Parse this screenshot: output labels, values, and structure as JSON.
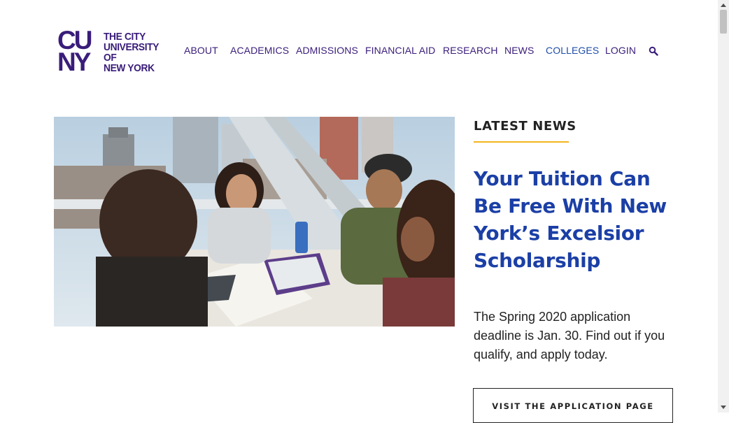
{
  "header": {
    "logo": {
      "mark_line1": "CU",
      "mark_line2": "NY",
      "text_lines": [
        "THE CITY",
        "UNIVERSITY",
        "OF",
        "NEW YORK"
      ]
    },
    "nav": [
      {
        "label": "ABOUT"
      },
      {
        "label": "ACADEMICS"
      },
      {
        "label": "ADMISSIONS"
      },
      {
        "label": "FINANCIAL AID"
      },
      {
        "label": "RESEARCH"
      },
      {
        "label": "NEWS"
      },
      {
        "label": "COLLEGES"
      },
      {
        "label": "LOGIN"
      }
    ],
    "search_icon": "search-icon"
  },
  "latest_news": {
    "heading": "LATEST NEWS",
    "headline": "Your Tuition Can Be Free With New York’s Excelsior Scholarship",
    "summary": "The Spring 2020 application deadline is Jan. 30. Find out if you qualify, and apply today.",
    "cta_label": "VISIT THE APPLICATION PAGE"
  },
  "colors": {
    "brand_purple": "#3a1d7a",
    "headline_blue": "#1b3fa6",
    "accent_gold": "#f3b51b"
  }
}
